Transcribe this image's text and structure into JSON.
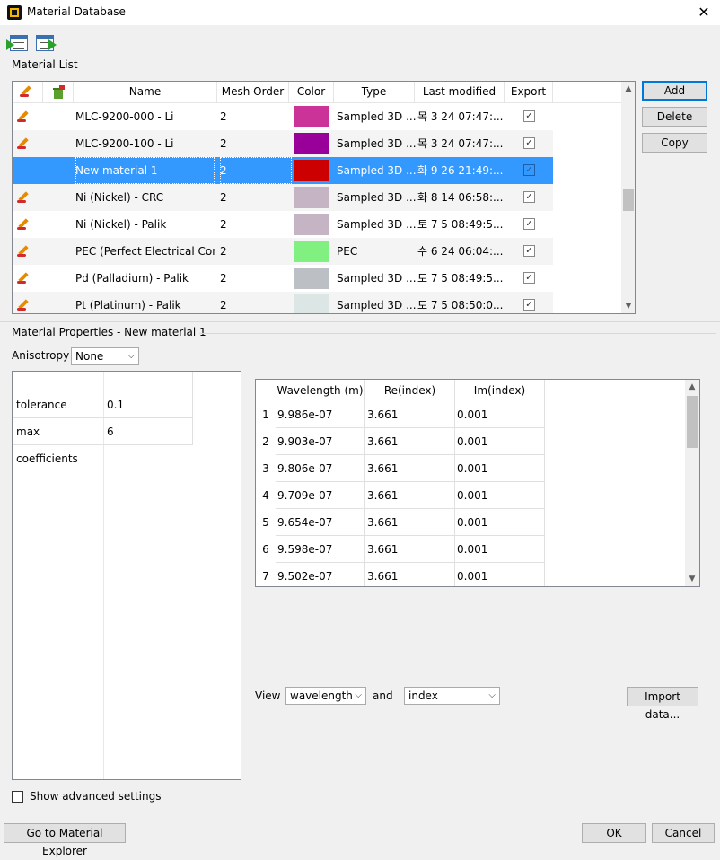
{
  "window": {
    "title": "Material Database",
    "close_glyph": "✕"
  },
  "toolbar": {
    "import_icon": "import-list-icon",
    "export_icon": "export-list-icon"
  },
  "material_list": {
    "label": "Material List",
    "columns": {
      "edit_icon": "pencil-icon",
      "delete_icon": "trash-icon",
      "name": "Name",
      "mesh_order": "Mesh Order",
      "color": "Color",
      "type": "Type",
      "last_modified": "Last modified",
      "export": "Export"
    },
    "rows": [
      {
        "name": "MLC-9200-000 - Li",
        "mesh": "2",
        "color": "#cc3399",
        "type": "Sampled 3D ...",
        "modified": "목 3 24 07:47:...",
        "export": "✓",
        "editable": true
      },
      {
        "name": "MLC-9200-100 - Li",
        "mesh": "2",
        "color": "#990099",
        "type": "Sampled 3D ...",
        "modified": "목 3 24 07:47:...",
        "export": "✓",
        "editable": true
      },
      {
        "name": "New material 1",
        "mesh": "2",
        "color": "#cc0000",
        "type": "Sampled 3D ...",
        "modified": "화 9 26 21:49:...",
        "export": "✓",
        "editable": false
      },
      {
        "name": "Ni (Nickel) - CRC",
        "mesh": "2",
        "color": "#c4b4c4",
        "type": "Sampled 3D ...",
        "modified": "화 8 14 06:58:...",
        "export": "✓",
        "editable": true
      },
      {
        "name": "Ni (Nickel) - Palik",
        "mesh": "2",
        "color": "#c4b4c4",
        "type": "Sampled 3D ...",
        "modified": "토 7 5 08:49:5...",
        "export": "✓",
        "editable": true
      },
      {
        "name": "PEC (Perfect Electrical Con...",
        "mesh": "2",
        "color": "#80f080",
        "type": "PEC",
        "modified": "수 6 24 06:04:...",
        "export": "✓",
        "editable": true
      },
      {
        "name": "Pd (Palladium) - Palik",
        "mesh": "2",
        "color": "#bcc0c4",
        "type": "Sampled 3D ...",
        "modified": "토 7 5 08:49:5...",
        "export": "✓",
        "editable": true
      },
      {
        "name": "Pt (Platinum) - Palik",
        "mesh": "2",
        "color": "#dce6e4",
        "type": "Sampled 3D ...",
        "modified": "토 7 5 08:50:0...",
        "export": "✓",
        "editable": true
      }
    ],
    "scroll_up": "▲",
    "scroll_down": "▼"
  },
  "buttons": {
    "add": "Add",
    "delete": "Delete",
    "copy": "Copy"
  },
  "properties": {
    "label": "Material Properties - New material 1",
    "anisotropy_label": "Anisotropy",
    "anisotropy_value": "None",
    "params": [
      {
        "name": "tolerance",
        "value": "0.1"
      },
      {
        "name": "max coefficients",
        "value": "6"
      }
    ],
    "table": {
      "headers": {
        "wavelength": "Wavelength (m)",
        "re": "Re(index)",
        "im": "Im(index)"
      },
      "rows": [
        {
          "n": "1",
          "wl": "9.986e-07",
          "re": "3.661",
          "im": "0.001"
        },
        {
          "n": "2",
          "wl": "9.903e-07",
          "re": "3.661",
          "im": "0.001"
        },
        {
          "n": "3",
          "wl": "9.806e-07",
          "re": "3.661",
          "im": "0.001"
        },
        {
          "n": "4",
          "wl": "9.709e-07",
          "re": "3.661",
          "im": "0.001"
        },
        {
          "n": "5",
          "wl": "9.654e-07",
          "re": "3.661",
          "im": "0.001"
        },
        {
          "n": "6",
          "wl": "9.598e-07",
          "re": "3.661",
          "im": "0.001"
        },
        {
          "n": "7",
          "wl": "9.502e-07",
          "re": "3.661",
          "im": "0.001"
        }
      ]
    },
    "view_label": "View",
    "view_value": "wavelength",
    "and_label": "and",
    "and_value": "index",
    "import_button": "Import data...",
    "show_advanced": "Show advanced settings"
  },
  "footer": {
    "explorer": "Go to Material Explorer",
    "ok": "OK",
    "cancel": "Cancel"
  },
  "chevron": "⌵"
}
